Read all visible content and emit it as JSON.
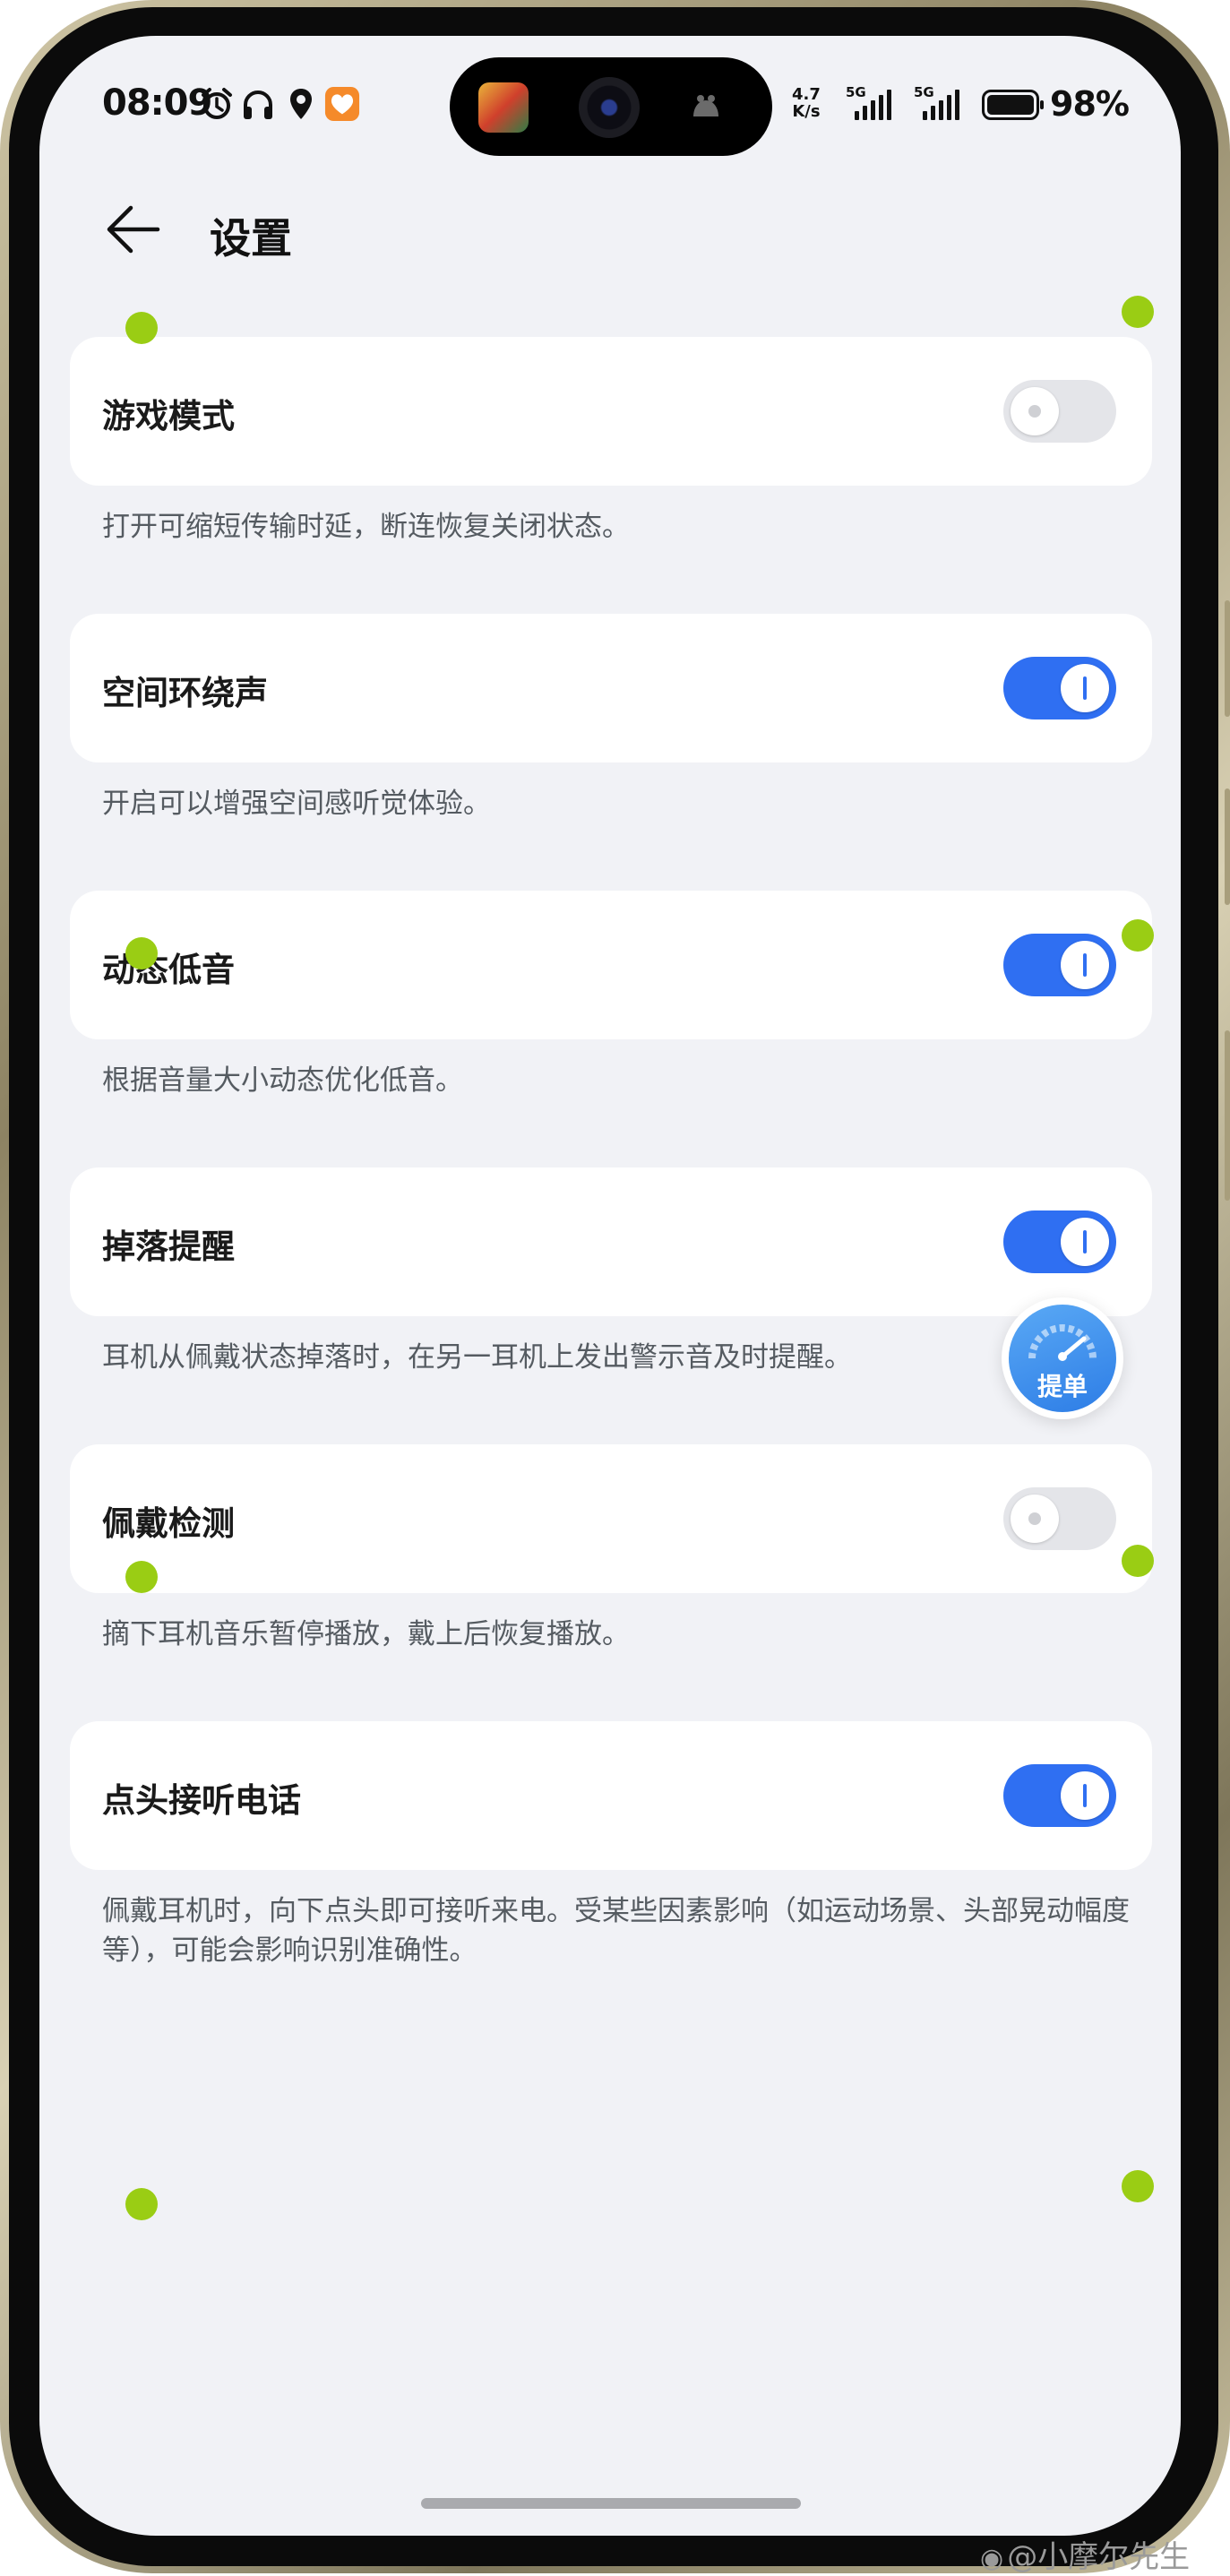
{
  "status_bar": {
    "time": "08:09",
    "net_speed_value": "4.7",
    "net_speed_unit": "K/s",
    "sim1_label": "5G",
    "sim2_label": "5G",
    "battery_percent": "98%"
  },
  "header": {
    "title": "设置"
  },
  "settings": [
    {
      "label": "游戏模式",
      "enabled": false,
      "description": "打开可缩短传输时延，断连恢复关闭状态。"
    },
    {
      "label": "空间环绕声",
      "enabled": true,
      "description": "开启可以增强空间感听觉体验。"
    },
    {
      "label": "动态低音",
      "enabled": true,
      "description": "根据音量大小动态优化低音。"
    },
    {
      "label": "掉落提醒",
      "enabled": true,
      "description": "耳机从佩戴状态掉落时，在另一耳机上发出警示音及时提醒。"
    },
    {
      "label": "佩戴检测",
      "enabled": false,
      "description": "摘下耳机音乐暂停播放，戴上后恢复播放。"
    },
    {
      "label": "点头接听电话",
      "enabled": true,
      "description": "佩戴耳机时，向下点头即可接听来电。受某些因素影响（如运动场景、头部晃动幅度等），可能会影响识别准确性。"
    }
  ],
  "floating_button": {
    "label": "提单"
  },
  "watermark": {
    "text": "@小摩尔先生"
  },
  "colors": {
    "accent": "#2f6ff2",
    "background": "#f1f2f6",
    "marker_dot": "#9acd14"
  }
}
